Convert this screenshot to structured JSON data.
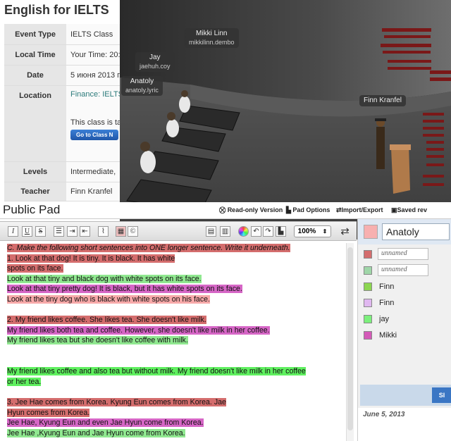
{
  "event": {
    "title": "English for IELTS",
    "rows": [
      {
        "label": "Event Type",
        "value": "IELTS Class"
      },
      {
        "label": "Local Time",
        "value": "Your Time: 20:"
      },
      {
        "label": "Date",
        "value": "5 июня 2013 г."
      },
      {
        "label": "Levels",
        "value": "Intermediate,"
      },
      {
        "label": "Teacher",
        "value": "Finn Kranfel"
      }
    ],
    "location": {
      "label": "Location",
      "link": "Finance: IELTS",
      "text": "This class is tak",
      "button": "Go to Class N"
    }
  },
  "scene": {
    "tags": [
      {
        "name": "Mikki Linn",
        "sub": "mikkilinn.dembo"
      },
      {
        "name": "Jay",
        "sub": "jaehuh.coy"
      },
      {
        "name": "Anatoly",
        "sub": "anatoly.lyric"
      },
      {
        "name": "Finn Kranfel",
        "sub": ""
      }
    ]
  },
  "pad": {
    "title": "Public Pad",
    "menu": {
      "readonly": "Read-only Version",
      "options": "Pad Options",
      "import_export": "Import/Export",
      "saved": "Saved rev"
    },
    "zoom": "100%",
    "lines": [
      {
        "text": "C. Make the following short sentences into ONE longer sentence. Write it underneath.",
        "style": "red italic"
      },
      {
        "text": "1. Look at that dog! It is tiny. It is black. It has white",
        "style": "red"
      },
      {
        "text": "spots on its face.",
        "style": "red"
      },
      {
        "text": "Look at that tiny and black dog with white spots on its face.",
        "style": "green"
      },
      {
        "text": "Look at that tiny pretty dog! It is black, but it has white spots on its face.",
        "style": "mag"
      },
      {
        "text": "Look at the tiny dog who is black with white spots on his face.",
        "style": "pink"
      },
      {
        "text": "",
        "style": "blank"
      },
      {
        "text": "2. My friend likes coffee. She likes tea. She doesn't like milk.",
        "style": "red"
      },
      {
        "text": "My friend likes both tea and coffee. However, she doesn't like milk in her coffee.",
        "style": "mag"
      },
      {
        "text": "My friend likes tea but she doesn't like coffee with milk.",
        "style": "green"
      },
      {
        "text": "",
        "style": "blank"
      },
      {
        "text": "",
        "style": "blank"
      },
      {
        "text": "My friend likes coffee and also tea but without milk.  My friend doesn't like milk in her coffee",
        "style": "brightgreen"
      },
      {
        "text": "or her tea.",
        "style": "brightgreen"
      },
      {
        "text": "",
        "style": "blank"
      },
      {
        "text": "3. Jee Hae comes from Korea. Kyung Eun comes from Korea. Jae",
        "style": "red"
      },
      {
        "text": "Hyun comes from Korea.",
        "style": "red"
      },
      {
        "text": "Jee Hae, Kyung Eun and even Jae Hyun come from Korea.",
        "style": "mag"
      },
      {
        "text": "Jee Hae ,Kyung Eun and Jae Hyun come from Korea.",
        "style": "green"
      }
    ]
  },
  "users": {
    "me": {
      "name": "Anatoly",
      "color": "#f7b0b0"
    },
    "list": [
      {
        "name": "unnamed",
        "color": "#d46d6d",
        "editable": true
      },
      {
        "name": "unnamed",
        "color": "#9fd6a8",
        "editable": true
      },
      {
        "name": "Finn",
        "color": "#8cd650",
        "editable": false
      },
      {
        "name": "Finn",
        "color": "#e0b8f0",
        "editable": false
      },
      {
        "name": "jay",
        "color": "#7cf07c",
        "editable": false
      },
      {
        "name": "Mikki",
        "color": "#d45ab8",
        "editable": false
      }
    ],
    "chat_button": "Sl",
    "date": "June 5, 2013"
  }
}
